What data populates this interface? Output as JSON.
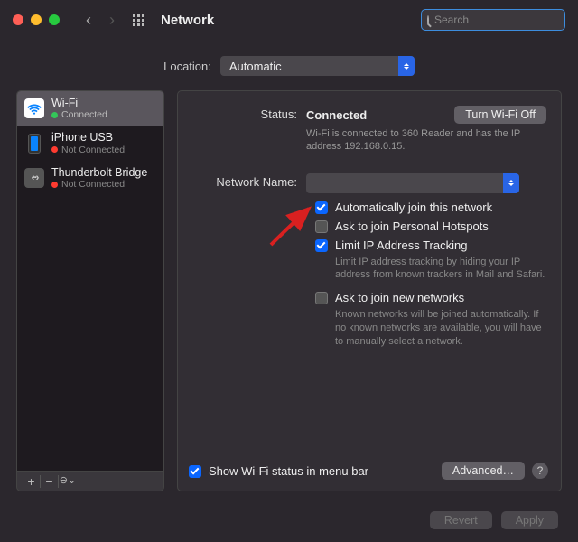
{
  "window": {
    "title": "Network",
    "search_placeholder": "Search"
  },
  "location": {
    "label": "Location:",
    "value": "Automatic"
  },
  "sidebar": {
    "items": [
      {
        "name": "Wi-Fi",
        "status": "Connected",
        "connected": true
      },
      {
        "name": "iPhone USB",
        "status": "Not Connected",
        "connected": false
      },
      {
        "name": "Thunderbolt Bridge",
        "status": "Not Connected",
        "connected": false
      }
    ],
    "footer_buttons": {
      "add": "+",
      "remove": "−",
      "more": "⊖⌄"
    }
  },
  "detail": {
    "status_label": "Status:",
    "status_value": "Connected",
    "wifi_off_btn": "Turn Wi-Fi Off",
    "status_sub": "Wi-Fi is connected to 360 Reader and has the IP address 192.168.0.15.",
    "network_name_label": "Network Name:",
    "network_name_value": "",
    "checks": {
      "auto_join": {
        "label": "Automatically join this network",
        "checked": true
      },
      "ask_hotspot": {
        "label": "Ask to join Personal Hotspots",
        "checked": false
      },
      "limit_ip": {
        "label": "Limit IP Address Tracking",
        "checked": true,
        "sub": "Limit IP address tracking by hiding your IP address from known trackers in Mail and Safari."
      },
      "ask_new": {
        "label": "Ask to join new networks",
        "checked": false,
        "sub": "Known networks will be joined automatically. If no known networks are available, you will have to manually select a network."
      }
    },
    "show_status_bar": {
      "label": "Show Wi-Fi status in menu bar",
      "checked": true
    },
    "advanced_btn": "Advanced…",
    "help": "?"
  },
  "footer": {
    "revert": "Revert",
    "apply": "Apply"
  }
}
